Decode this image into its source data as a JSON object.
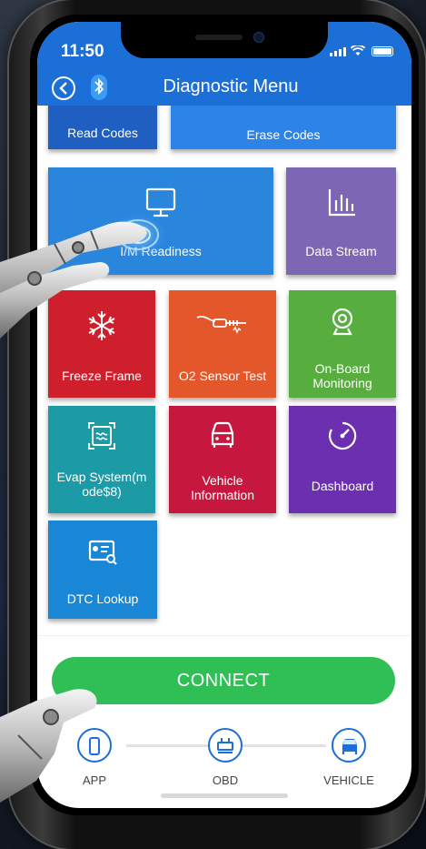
{
  "status": {
    "time": "11:50"
  },
  "header": {
    "title": "Diagnostic Menu"
  },
  "tiles": [
    {
      "label": "Read Codes",
      "color": "#1f5fc2",
      "icon": "none"
    },
    {
      "label": "Erase Codes",
      "color": "#2d84e6",
      "icon": "none"
    },
    {
      "label": "I/M Readiness",
      "color": "#2a86dc",
      "icon": "monitor-icon"
    },
    {
      "label": "Data Stream",
      "color": "#7d66b3",
      "icon": "bar-chart-icon"
    },
    {
      "label": "Freeze Frame",
      "color": "#cf1f2c",
      "icon": "snowflake-icon"
    },
    {
      "label": "O2 Sensor Test",
      "color": "#e4572a",
      "icon": "sensor-icon"
    },
    {
      "label": "On-Board Monitoring",
      "color": "#57ad3d",
      "icon": "webcam-icon"
    },
    {
      "label": "Evap System(mode$8)",
      "color": "#1c9aa6",
      "icon": "evap-icon"
    },
    {
      "label": "Vehicle Information",
      "color": "#c6183f",
      "icon": "car-icon"
    },
    {
      "label": "Dashboard",
      "color": "#6c2fb0",
      "icon": "gauge-icon"
    },
    {
      "label": "DTC Lookup",
      "color": "#1a86d6",
      "icon": "lookup-icon"
    }
  ],
  "labels": {
    "read": "Read Codes",
    "erase": "Erase Codes",
    "im": "I/M Readiness",
    "data": "Data Stream",
    "freeze": "Freeze Frame",
    "o2": "O2 Sensor Test",
    "onboard1": "On-Board",
    "onboard2": "Monitoring",
    "evap1": "Evap System(m",
    "evap2": "ode$8)",
    "vehicle1": "Vehicle",
    "vehicle2": "Information",
    "dashboard": "Dashboard",
    "dtc": "DTC Lookup"
  },
  "connect": {
    "label": "CONNECT"
  },
  "steps": [
    {
      "label": "APP",
      "icon": "phone-icon"
    },
    {
      "label": "OBD",
      "icon": "obd-icon"
    },
    {
      "label": "VEHICLE",
      "icon": "car-icon"
    }
  ],
  "colors": {
    "accent": "#1d6fd8",
    "connect": "#2fbf55"
  }
}
